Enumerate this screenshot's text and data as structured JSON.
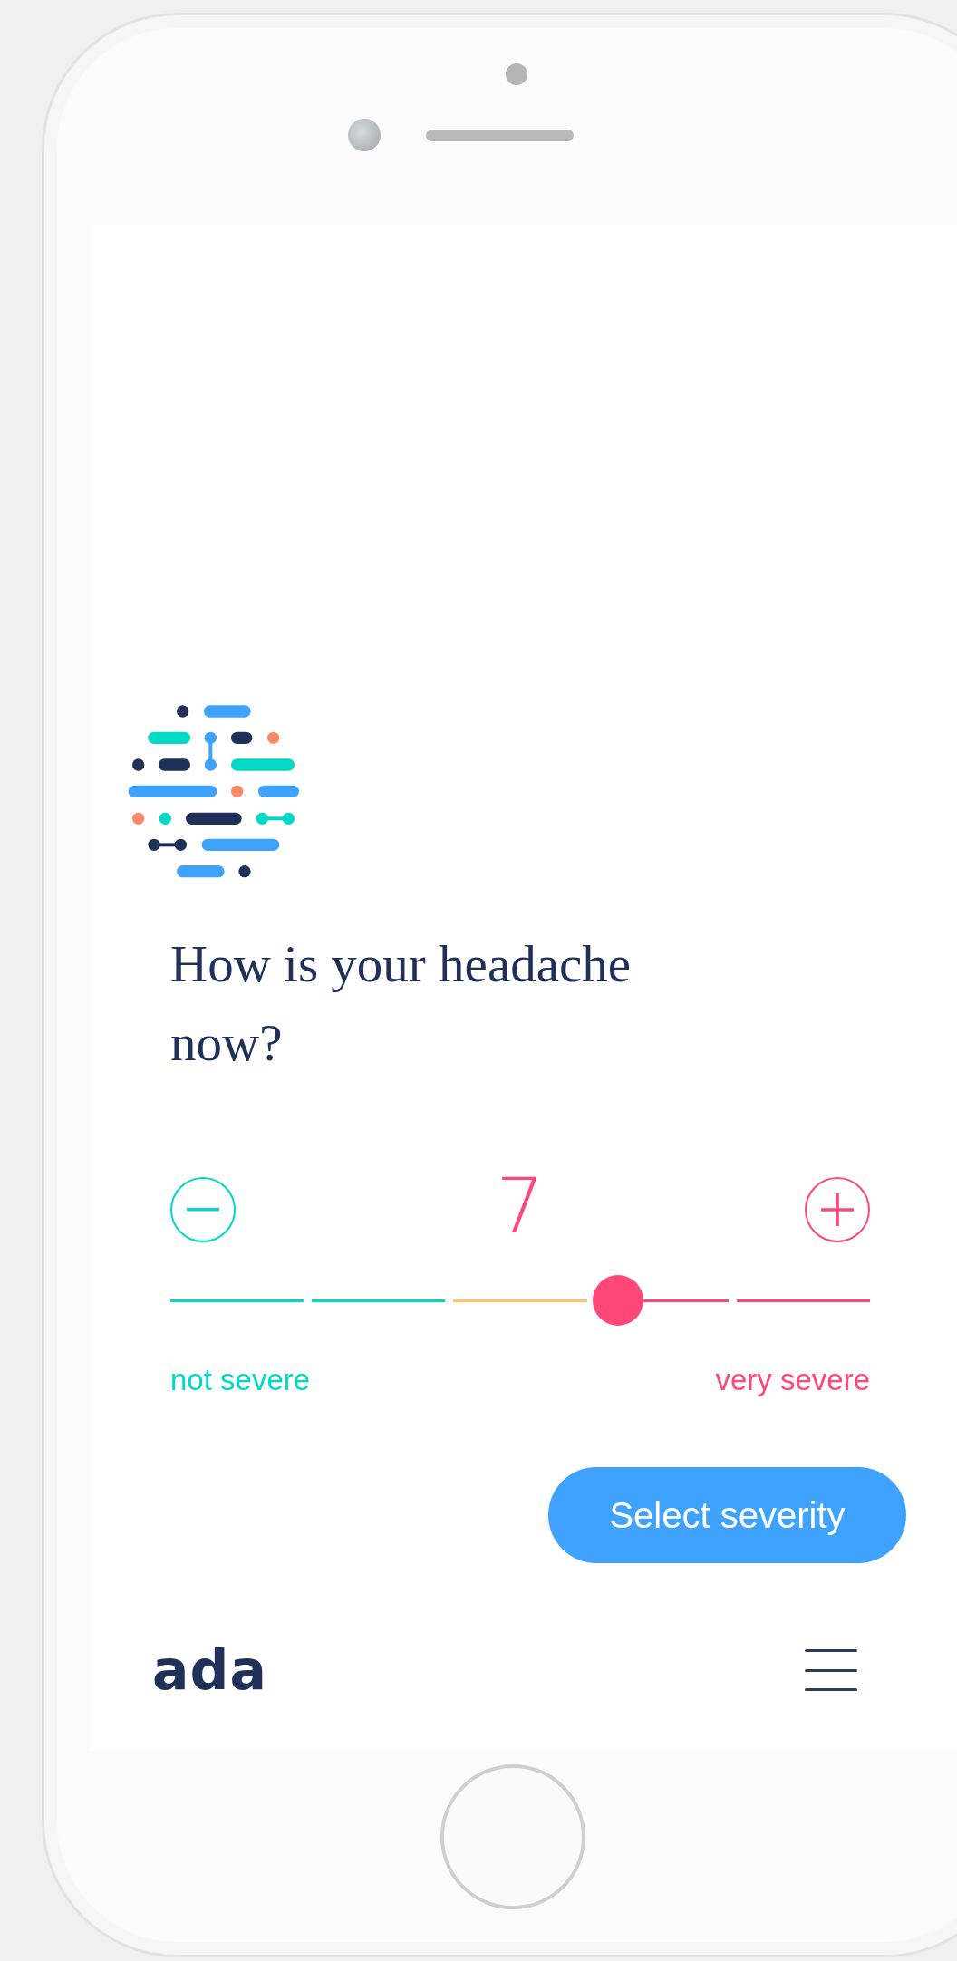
{
  "question": "How is your headache now?",
  "severity": {
    "value": "7",
    "level": 0.64,
    "segments": [
      {
        "color": "#00d9c6"
      },
      {
        "color": "#00d9c6"
      },
      {
        "color": "#ffc668"
      },
      {
        "color": "#ff4778"
      },
      {
        "color": "#ff4778"
      }
    ],
    "min_label": "not severe",
    "max_label": "very severe"
  },
  "button": "Select severity",
  "footer": {
    "brand": "ada"
  }
}
